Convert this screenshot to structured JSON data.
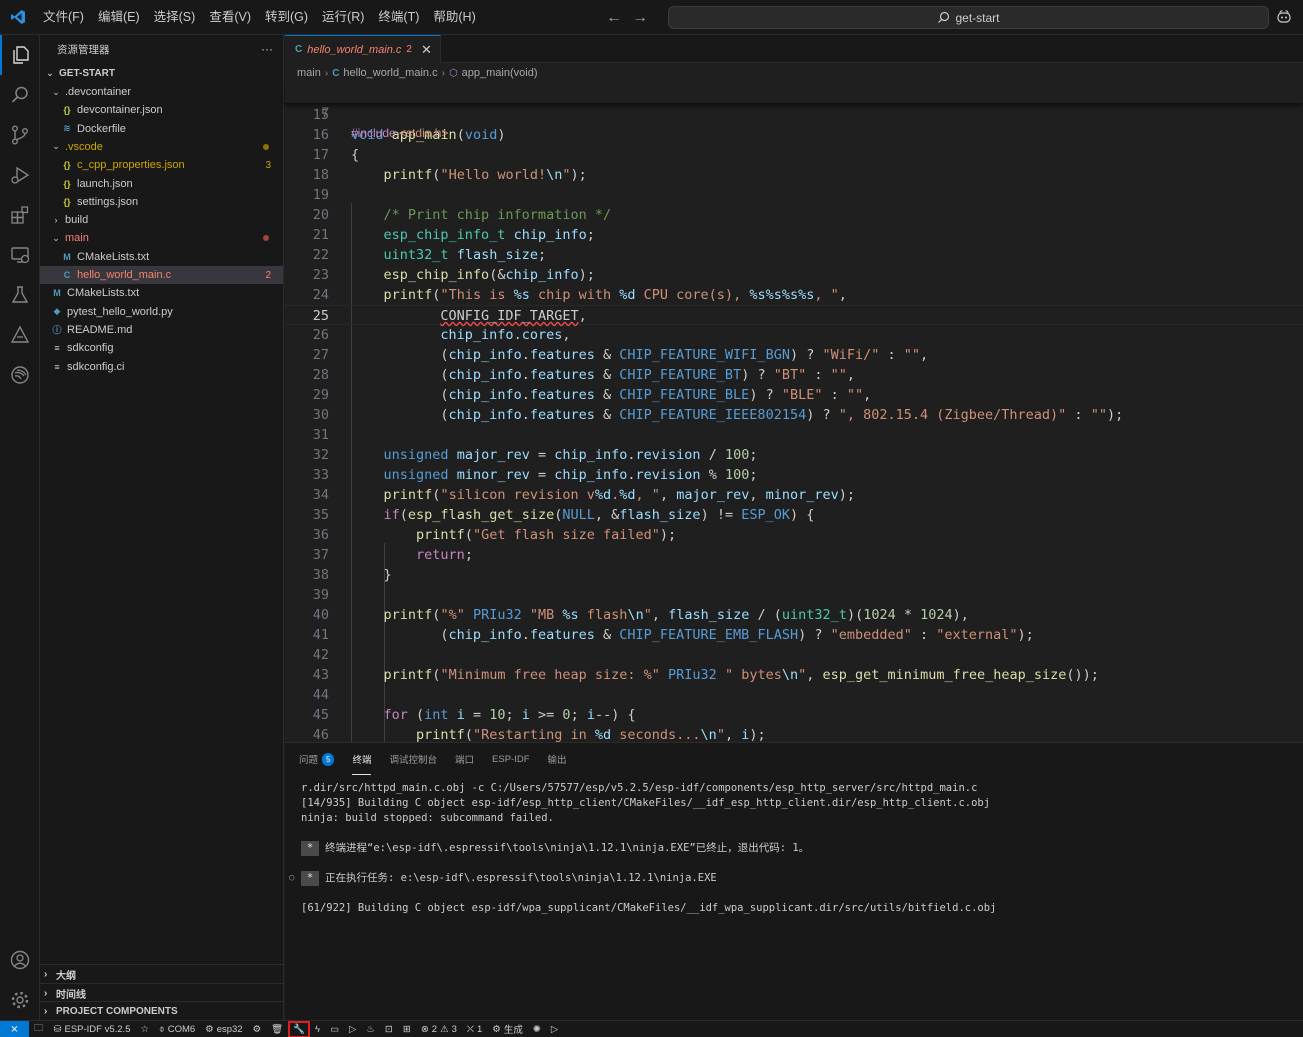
{
  "menu": {
    "items": [
      "文件(F)",
      "编辑(E)",
      "选择(S)",
      "查看(V)",
      "转到(G)",
      "运行(R)",
      "终端(T)",
      "帮助(H)"
    ]
  },
  "search": {
    "text": "get-start"
  },
  "activity_icons": [
    "explorer-icon",
    "search-icon",
    "source-control-icon",
    "run-debug-icon",
    "extensions-icon",
    "remote-explorer-icon",
    "testing-icon",
    "idf-icon",
    "espressif-icon",
    "accounts-icon",
    "settings-gear-icon"
  ],
  "sidebar": {
    "title": "资源管理器",
    "more": "···",
    "root": "GET-START",
    "tree": [
      {
        "label": ".devcontainer",
        "type": "folder",
        "open": true,
        "depth": 1
      },
      {
        "label": "devcontainer.json",
        "type": "json",
        "depth": 2
      },
      {
        "label": "Dockerfile",
        "type": "docker",
        "depth": 2
      },
      {
        "label": ".vscode",
        "type": "folder",
        "open": true,
        "depth": 1,
        "color": "#cca700",
        "dot": "#8a7200"
      },
      {
        "label": "c_cpp_properties.json",
        "type": "json",
        "depth": 2,
        "color": "#cca700",
        "badge": "3"
      },
      {
        "label": "launch.json",
        "type": "json",
        "depth": 2
      },
      {
        "label": "settings.json",
        "type": "json",
        "depth": 2
      },
      {
        "label": "build",
        "type": "folder",
        "open": false,
        "depth": 1
      },
      {
        "label": "main",
        "type": "folder",
        "open": true,
        "depth": 1,
        "color": "#f88070",
        "dot": "#a0453d"
      },
      {
        "label": "CMakeLists.txt",
        "type": "cmake",
        "depth": 2
      },
      {
        "label": "hello_world_main.c",
        "type": "c",
        "depth": 2,
        "color": "#f88070",
        "badge": "2",
        "selected": true
      },
      {
        "label": "CMakeLists.txt",
        "type": "cmake",
        "depth": 1
      },
      {
        "label": "pytest_hello_world.py",
        "type": "py",
        "depth": 1
      },
      {
        "label": "README.md",
        "type": "md",
        "depth": 1
      },
      {
        "label": "sdkconfig",
        "type": "cfg",
        "depth": 1
      },
      {
        "label": "sdkconfig.ci",
        "type": "cfg",
        "depth": 1
      }
    ],
    "bottom_sections": [
      "大纲",
      "时间线",
      "PROJECT COMPONENTS"
    ]
  },
  "editor": {
    "tab": {
      "label": "hello_world_main.c",
      "problems": "2",
      "icon": "C"
    },
    "breadcrumbs": [
      "main",
      "hello_world_main.c",
      "app_main(void)"
    ],
    "sticky": {
      "ln": "7",
      "code": "#include <stdio.h>"
    },
    "current_line": "25",
    "lines": [
      {
        "ln": "15",
        "code": ""
      },
      {
        "ln": "16",
        "code": "void app_main(void)"
      },
      {
        "ln": "17",
        "code": "{"
      },
      {
        "ln": "18",
        "code": "    printf(\"Hello world!\\n\");"
      },
      {
        "ln": "19",
        "code": ""
      },
      {
        "ln": "20",
        "code": "    /* Print chip information */"
      },
      {
        "ln": "21",
        "code": "    esp_chip_info_t chip_info;"
      },
      {
        "ln": "22",
        "code": "    uint32_t flash_size;"
      },
      {
        "ln": "23",
        "code": "    esp_chip_info(&chip_info);"
      },
      {
        "ln": "24",
        "code": "    printf(\"This is %s chip with %d CPU core(s), %s%s%s%s, \","
      },
      {
        "ln": "25",
        "code": "           CONFIG_IDF_TARGET,"
      },
      {
        "ln": "26",
        "code": "           chip_info.cores,"
      },
      {
        "ln": "27",
        "code": "           (chip_info.features & CHIP_FEATURE_WIFI_BGN) ? \"WiFi/\" : \"\","
      },
      {
        "ln": "28",
        "code": "           (chip_info.features & CHIP_FEATURE_BT) ? \"BT\" : \"\","
      },
      {
        "ln": "29",
        "code": "           (chip_info.features & CHIP_FEATURE_BLE) ? \"BLE\" : \"\","
      },
      {
        "ln": "30",
        "code": "           (chip_info.features & CHIP_FEATURE_IEEE802154) ? \", 802.15.4 (Zigbee/Thread)\" : \"\");"
      },
      {
        "ln": "31",
        "code": ""
      },
      {
        "ln": "32",
        "code": "    unsigned major_rev = chip_info.revision / 100;"
      },
      {
        "ln": "33",
        "code": "    unsigned minor_rev = chip_info.revision % 100;"
      },
      {
        "ln": "34",
        "code": "    printf(\"silicon revision v%d.%d, \", major_rev, minor_rev);"
      },
      {
        "ln": "35",
        "code": "    if(esp_flash_get_size(NULL, &flash_size) != ESP_OK) {"
      },
      {
        "ln": "36",
        "code": "        printf(\"Get flash size failed\");"
      },
      {
        "ln": "37",
        "code": "        return;"
      },
      {
        "ln": "38",
        "code": "    }"
      },
      {
        "ln": "39",
        "code": ""
      },
      {
        "ln": "40",
        "code": "    printf(\"%\" PRIu32 \"MB %s flash\\n\", flash_size / (uint32_t)(1024 * 1024),"
      },
      {
        "ln": "41",
        "code": "           (chip_info.features & CHIP_FEATURE_EMB_FLASH) ? \"embedded\" : \"external\");"
      },
      {
        "ln": "42",
        "code": ""
      },
      {
        "ln": "43",
        "code": "    printf(\"Minimum free heap size: %\" PRIu32 \" bytes\\n\", esp_get_minimum_free_heap_size());"
      },
      {
        "ln": "44",
        "code": ""
      },
      {
        "ln": "45",
        "code": "    for (int i = 10; i >= 0; i--) {"
      },
      {
        "ln": "46",
        "code": "        printf(\"Restarting in %d seconds...\\n\", i);"
      }
    ]
  },
  "panel": {
    "tabs": [
      {
        "label": "问题",
        "badge": "5"
      },
      {
        "label": "终端",
        "active": true
      },
      {
        "label": "调试控制台"
      },
      {
        "label": "端口"
      },
      {
        "label": "ESP-IDF"
      },
      {
        "label": "输出"
      }
    ],
    "terminal": {
      "line1": "r.dir/src/httpd_main.c.obj -c C:/Users/57577/esp/v5.2.5/esp-idf/components/esp_http_server/src/httpd_main.c",
      "line2": "[14/935] Building C object esp-idf/esp_http_client/CMakeFiles/__idf_esp_http_client.dir/esp_http_client.c.obj",
      "line3": "ninja: build stopped: subcommand failed.",
      "star": "*",
      "line4": "终端进程“e:\\esp-idf\\.espressif\\tools\\ninja\\1.12.1\\ninja.EXE”已终止，退出代码: 1。",
      "line5": "正在执行任务: e:\\esp-idf\\.espressif\\tools\\ninja\\1.12.1\\ninja.EXE",
      "line6": "[61/922] Building C object esp-idf/wpa_supplicant/CMakeFiles/__idf_wpa_supplicant.dir/src/utils/bitfield.c.obj"
    }
  },
  "statusbar": {
    "remote": "⨯",
    "idf_version": "ESP-IDF v5.2.5",
    "port": "COM6",
    "target": "esp32",
    "errors": "2",
    "warnings": "3",
    "ports_count": "1",
    "build": "生成"
  }
}
